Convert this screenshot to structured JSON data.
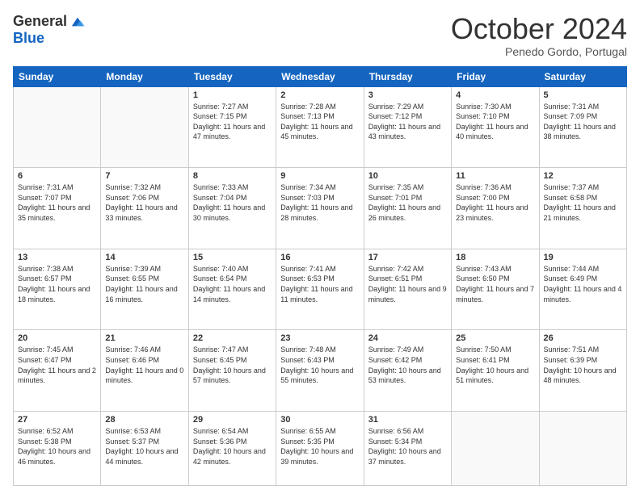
{
  "logo": {
    "general": "General",
    "blue": "Blue"
  },
  "header": {
    "month": "October 2024",
    "location": "Penedo Gordo, Portugal"
  },
  "weekdays": [
    "Sunday",
    "Monday",
    "Tuesday",
    "Wednesday",
    "Thursday",
    "Friday",
    "Saturday"
  ],
  "weeks": [
    [
      {
        "day": "",
        "sunrise": "",
        "sunset": "",
        "daylight": ""
      },
      {
        "day": "",
        "sunrise": "",
        "sunset": "",
        "daylight": ""
      },
      {
        "day": "1",
        "sunrise": "Sunrise: 7:27 AM",
        "sunset": "Sunset: 7:15 PM",
        "daylight": "Daylight: 11 hours and 47 minutes."
      },
      {
        "day": "2",
        "sunrise": "Sunrise: 7:28 AM",
        "sunset": "Sunset: 7:13 PM",
        "daylight": "Daylight: 11 hours and 45 minutes."
      },
      {
        "day": "3",
        "sunrise": "Sunrise: 7:29 AM",
        "sunset": "Sunset: 7:12 PM",
        "daylight": "Daylight: 11 hours and 43 minutes."
      },
      {
        "day": "4",
        "sunrise": "Sunrise: 7:30 AM",
        "sunset": "Sunset: 7:10 PM",
        "daylight": "Daylight: 11 hours and 40 minutes."
      },
      {
        "day": "5",
        "sunrise": "Sunrise: 7:31 AM",
        "sunset": "Sunset: 7:09 PM",
        "daylight": "Daylight: 11 hours and 38 minutes."
      }
    ],
    [
      {
        "day": "6",
        "sunrise": "Sunrise: 7:31 AM",
        "sunset": "Sunset: 7:07 PM",
        "daylight": "Daylight: 11 hours and 35 minutes."
      },
      {
        "day": "7",
        "sunrise": "Sunrise: 7:32 AM",
        "sunset": "Sunset: 7:06 PM",
        "daylight": "Daylight: 11 hours and 33 minutes."
      },
      {
        "day": "8",
        "sunrise": "Sunrise: 7:33 AM",
        "sunset": "Sunset: 7:04 PM",
        "daylight": "Daylight: 11 hours and 30 minutes."
      },
      {
        "day": "9",
        "sunrise": "Sunrise: 7:34 AM",
        "sunset": "Sunset: 7:03 PM",
        "daylight": "Daylight: 11 hours and 28 minutes."
      },
      {
        "day": "10",
        "sunrise": "Sunrise: 7:35 AM",
        "sunset": "Sunset: 7:01 PM",
        "daylight": "Daylight: 11 hours and 26 minutes."
      },
      {
        "day": "11",
        "sunrise": "Sunrise: 7:36 AM",
        "sunset": "Sunset: 7:00 PM",
        "daylight": "Daylight: 11 hours and 23 minutes."
      },
      {
        "day": "12",
        "sunrise": "Sunrise: 7:37 AM",
        "sunset": "Sunset: 6:58 PM",
        "daylight": "Daylight: 11 hours and 21 minutes."
      }
    ],
    [
      {
        "day": "13",
        "sunrise": "Sunrise: 7:38 AM",
        "sunset": "Sunset: 6:57 PM",
        "daylight": "Daylight: 11 hours and 18 minutes."
      },
      {
        "day": "14",
        "sunrise": "Sunrise: 7:39 AM",
        "sunset": "Sunset: 6:55 PM",
        "daylight": "Daylight: 11 hours and 16 minutes."
      },
      {
        "day": "15",
        "sunrise": "Sunrise: 7:40 AM",
        "sunset": "Sunset: 6:54 PM",
        "daylight": "Daylight: 11 hours and 14 minutes."
      },
      {
        "day": "16",
        "sunrise": "Sunrise: 7:41 AM",
        "sunset": "Sunset: 6:53 PM",
        "daylight": "Daylight: 11 hours and 11 minutes."
      },
      {
        "day": "17",
        "sunrise": "Sunrise: 7:42 AM",
        "sunset": "Sunset: 6:51 PM",
        "daylight": "Daylight: 11 hours and 9 minutes."
      },
      {
        "day": "18",
        "sunrise": "Sunrise: 7:43 AM",
        "sunset": "Sunset: 6:50 PM",
        "daylight": "Daylight: 11 hours and 7 minutes."
      },
      {
        "day": "19",
        "sunrise": "Sunrise: 7:44 AM",
        "sunset": "Sunset: 6:49 PM",
        "daylight": "Daylight: 11 hours and 4 minutes."
      }
    ],
    [
      {
        "day": "20",
        "sunrise": "Sunrise: 7:45 AM",
        "sunset": "Sunset: 6:47 PM",
        "daylight": "Daylight: 11 hours and 2 minutes."
      },
      {
        "day": "21",
        "sunrise": "Sunrise: 7:46 AM",
        "sunset": "Sunset: 6:46 PM",
        "daylight": "Daylight: 11 hours and 0 minutes."
      },
      {
        "day": "22",
        "sunrise": "Sunrise: 7:47 AM",
        "sunset": "Sunset: 6:45 PM",
        "daylight": "Daylight: 10 hours and 57 minutes."
      },
      {
        "day": "23",
        "sunrise": "Sunrise: 7:48 AM",
        "sunset": "Sunset: 6:43 PM",
        "daylight": "Daylight: 10 hours and 55 minutes."
      },
      {
        "day": "24",
        "sunrise": "Sunrise: 7:49 AM",
        "sunset": "Sunset: 6:42 PM",
        "daylight": "Daylight: 10 hours and 53 minutes."
      },
      {
        "day": "25",
        "sunrise": "Sunrise: 7:50 AM",
        "sunset": "Sunset: 6:41 PM",
        "daylight": "Daylight: 10 hours and 51 minutes."
      },
      {
        "day": "26",
        "sunrise": "Sunrise: 7:51 AM",
        "sunset": "Sunset: 6:39 PM",
        "daylight": "Daylight: 10 hours and 48 minutes."
      }
    ],
    [
      {
        "day": "27",
        "sunrise": "Sunrise: 6:52 AM",
        "sunset": "Sunset: 5:38 PM",
        "daylight": "Daylight: 10 hours and 46 minutes."
      },
      {
        "day": "28",
        "sunrise": "Sunrise: 6:53 AM",
        "sunset": "Sunset: 5:37 PM",
        "daylight": "Daylight: 10 hours and 44 minutes."
      },
      {
        "day": "29",
        "sunrise": "Sunrise: 6:54 AM",
        "sunset": "Sunset: 5:36 PM",
        "daylight": "Daylight: 10 hours and 42 minutes."
      },
      {
        "day": "30",
        "sunrise": "Sunrise: 6:55 AM",
        "sunset": "Sunset: 5:35 PM",
        "daylight": "Daylight: 10 hours and 39 minutes."
      },
      {
        "day": "31",
        "sunrise": "Sunrise: 6:56 AM",
        "sunset": "Sunset: 5:34 PM",
        "daylight": "Daylight: 10 hours and 37 minutes."
      },
      {
        "day": "",
        "sunrise": "",
        "sunset": "",
        "daylight": ""
      },
      {
        "day": "",
        "sunrise": "",
        "sunset": "",
        "daylight": ""
      }
    ]
  ]
}
